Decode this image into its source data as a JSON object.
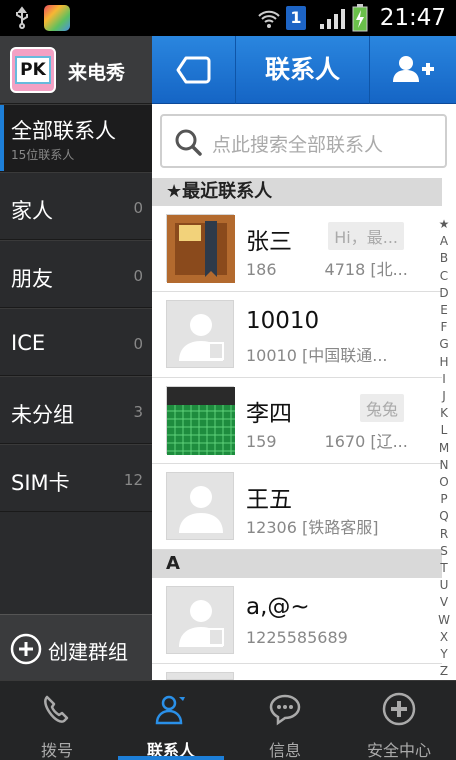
{
  "status_bar": {
    "time": "21:47",
    "notification_count": "1"
  },
  "app": {
    "title": "来电秀",
    "logo_text": "PK"
  },
  "groups": [
    {
      "name": "全部联系人",
      "sub": "15位联系人",
      "count": "",
      "active": true
    },
    {
      "name": "家人",
      "count": "0"
    },
    {
      "name": "朋友",
      "count": "0"
    },
    {
      "name": "ICE",
      "count": "0"
    },
    {
      "name": "未分组",
      "count": "3"
    },
    {
      "name": "SIM卡",
      "count": "12"
    }
  ],
  "create_group_label": "创建群组",
  "header": {
    "title": "联系人"
  },
  "search": {
    "placeholder": "点此搜索全部联系人"
  },
  "sections": {
    "recent": "★最近联系人",
    "a": "A"
  },
  "contacts": [
    {
      "name": "张三",
      "number": "186　　　4718 [北...",
      "tag": "Hi，最..."
    },
    {
      "name": "10010",
      "number": "10010 [中国联通...",
      "tag": ""
    },
    {
      "name": "李四",
      "number": "159　　　1670 [辽...",
      "tag": "兔兔"
    },
    {
      "name": "王五",
      "number": "12306 [铁路客服]",
      "tag": ""
    },
    {
      "name": "a,@~",
      "number": "1225585689",
      "tag": ""
    }
  ],
  "index_letters": [
    "★",
    "A",
    "B",
    "C",
    "D",
    "E",
    "F",
    "G",
    "H",
    "I",
    "J",
    "K",
    "L",
    "M",
    "N",
    "O",
    "P",
    "Q",
    "R",
    "S",
    "T",
    "U",
    "V",
    "W",
    "X",
    "Y",
    "Z",
    "#"
  ],
  "bottom_nav": [
    {
      "label": "拨号",
      "icon": "phone-icon"
    },
    {
      "label": "联系人",
      "icon": "contacts-icon",
      "active": true
    },
    {
      "label": "信息",
      "icon": "message-icon"
    },
    {
      "label": "安全中心",
      "icon": "shield-plus-icon"
    }
  ],
  "colors": {
    "accent": "#1d7fd8",
    "panel_dark": "#2a2b2d"
  }
}
